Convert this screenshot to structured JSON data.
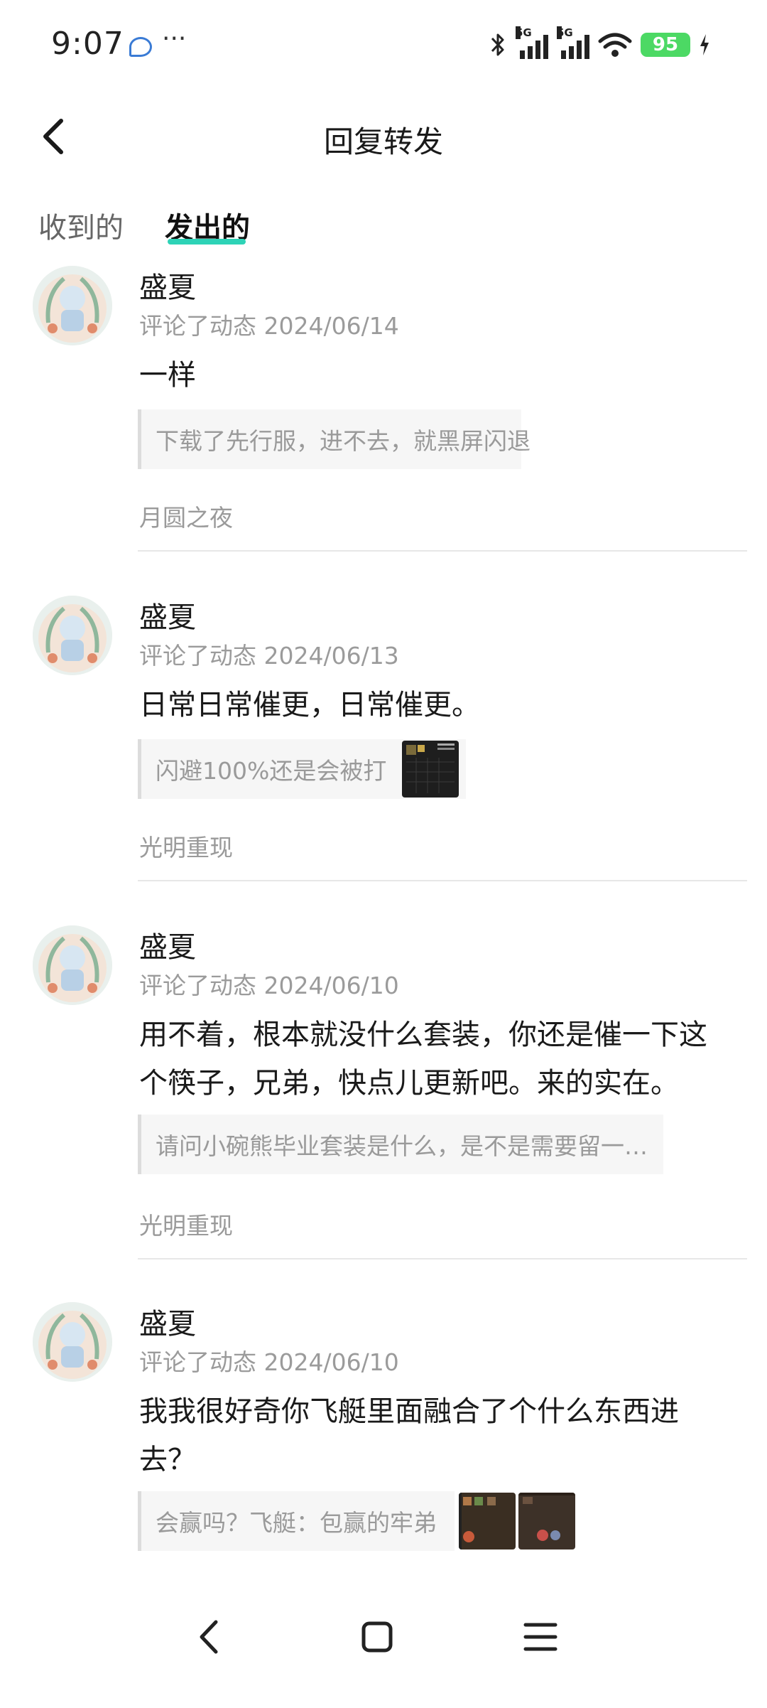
{
  "status_bar": {
    "time": "9:07",
    "signal_1_label": "5G",
    "signal_2_label": "5G",
    "battery": "95",
    "icons": [
      "chat-bubble-icon",
      "more-dots-icon",
      "bluetooth-icon",
      "signal-icon",
      "signal-icon",
      "wifi-icon",
      "battery-icon",
      "charging-bolt-icon"
    ]
  },
  "header": {
    "title": "回复转发",
    "back_icon": "chevron-left-icon"
  },
  "tabs": [
    {
      "label": "收到的",
      "active": false
    },
    {
      "label": "发出的",
      "active": true
    }
  ],
  "accent_color": "#2ed3b7",
  "items": [
    {
      "name": "盛夏",
      "meta": "评论了动态 2024/06/14",
      "comment": "一样",
      "quote": "下载了先行服，进不去，就黑屏闪退",
      "thumbs": 0,
      "source": "月圆之夜"
    },
    {
      "name": "盛夏",
      "meta": "评论了动态 2024/06/13",
      "comment": "日常日常催更，日常催更。",
      "quote": "闪避100%还是会被打",
      "thumbs": 1,
      "source": "光明重现"
    },
    {
      "name": "盛夏",
      "meta": "评论了动态 2024/06/10",
      "comment": "用不着，根本就没什么套装，你还是催一下这个筷子，兄弟，快点儿更新吧。来的实在。",
      "quote": "请问小碗熊毕业套装是什么，是不是需要留一…",
      "thumbs": 0,
      "source": "光明重现"
    },
    {
      "name": "盛夏",
      "meta": "评论了动态 2024/06/10",
      "comment": "我我很好奇你飞艇里面融合了个什么东西进去？",
      "quote": "会赢吗？飞艇：包赢的牢弟",
      "thumbs": 2,
      "source": ""
    }
  ],
  "nav_bar": {
    "buttons": [
      "back-nav-icon",
      "home-nav-icon",
      "menu-nav-icon"
    ]
  }
}
